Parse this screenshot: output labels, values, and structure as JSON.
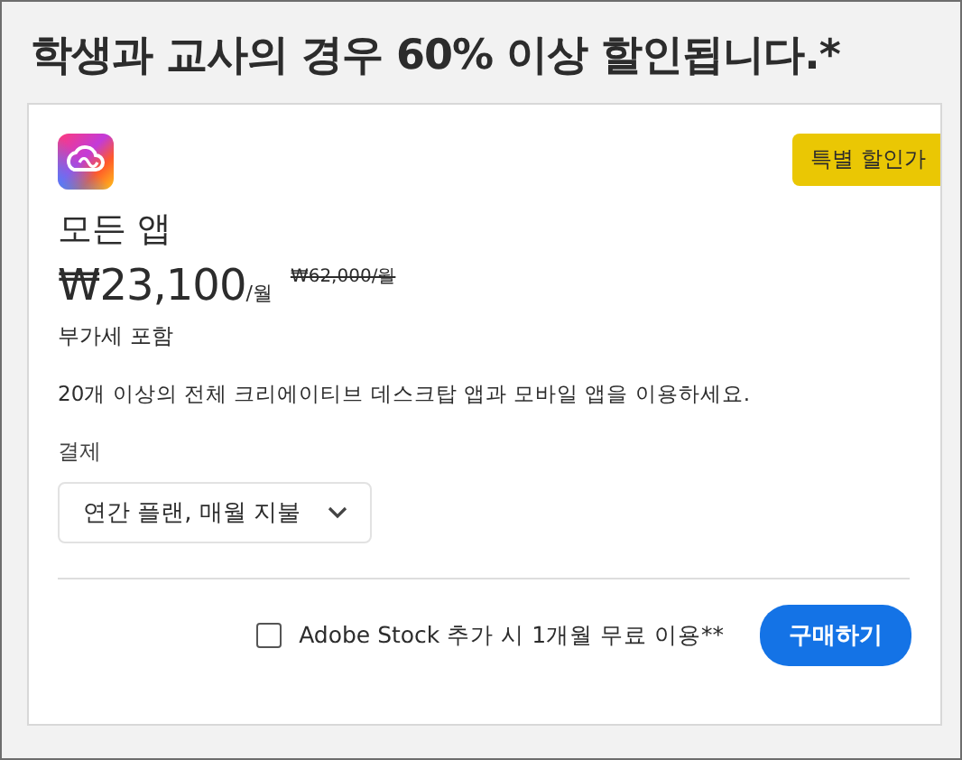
{
  "headline": "학생과 교사의 경우 60% 이상 할인됩니다.*",
  "card": {
    "badge": "특별 할인가",
    "product": "모든 앱",
    "price": "₩23,100",
    "per": "/월",
    "old_price": "₩62,000/월",
    "vat": "부가세 포함",
    "description": "20개 이상의 전체 크리에이티브 데스크탑 앱과 모바일 앱을 이용하세요.",
    "billing_label": "결제",
    "billing_value": "연간 플랜, 매월 지불",
    "addon": {
      "label": "Adobe Stock 추가 시 1개월 무료 이용**",
      "checked": false
    },
    "buy_button": "구매하기"
  }
}
